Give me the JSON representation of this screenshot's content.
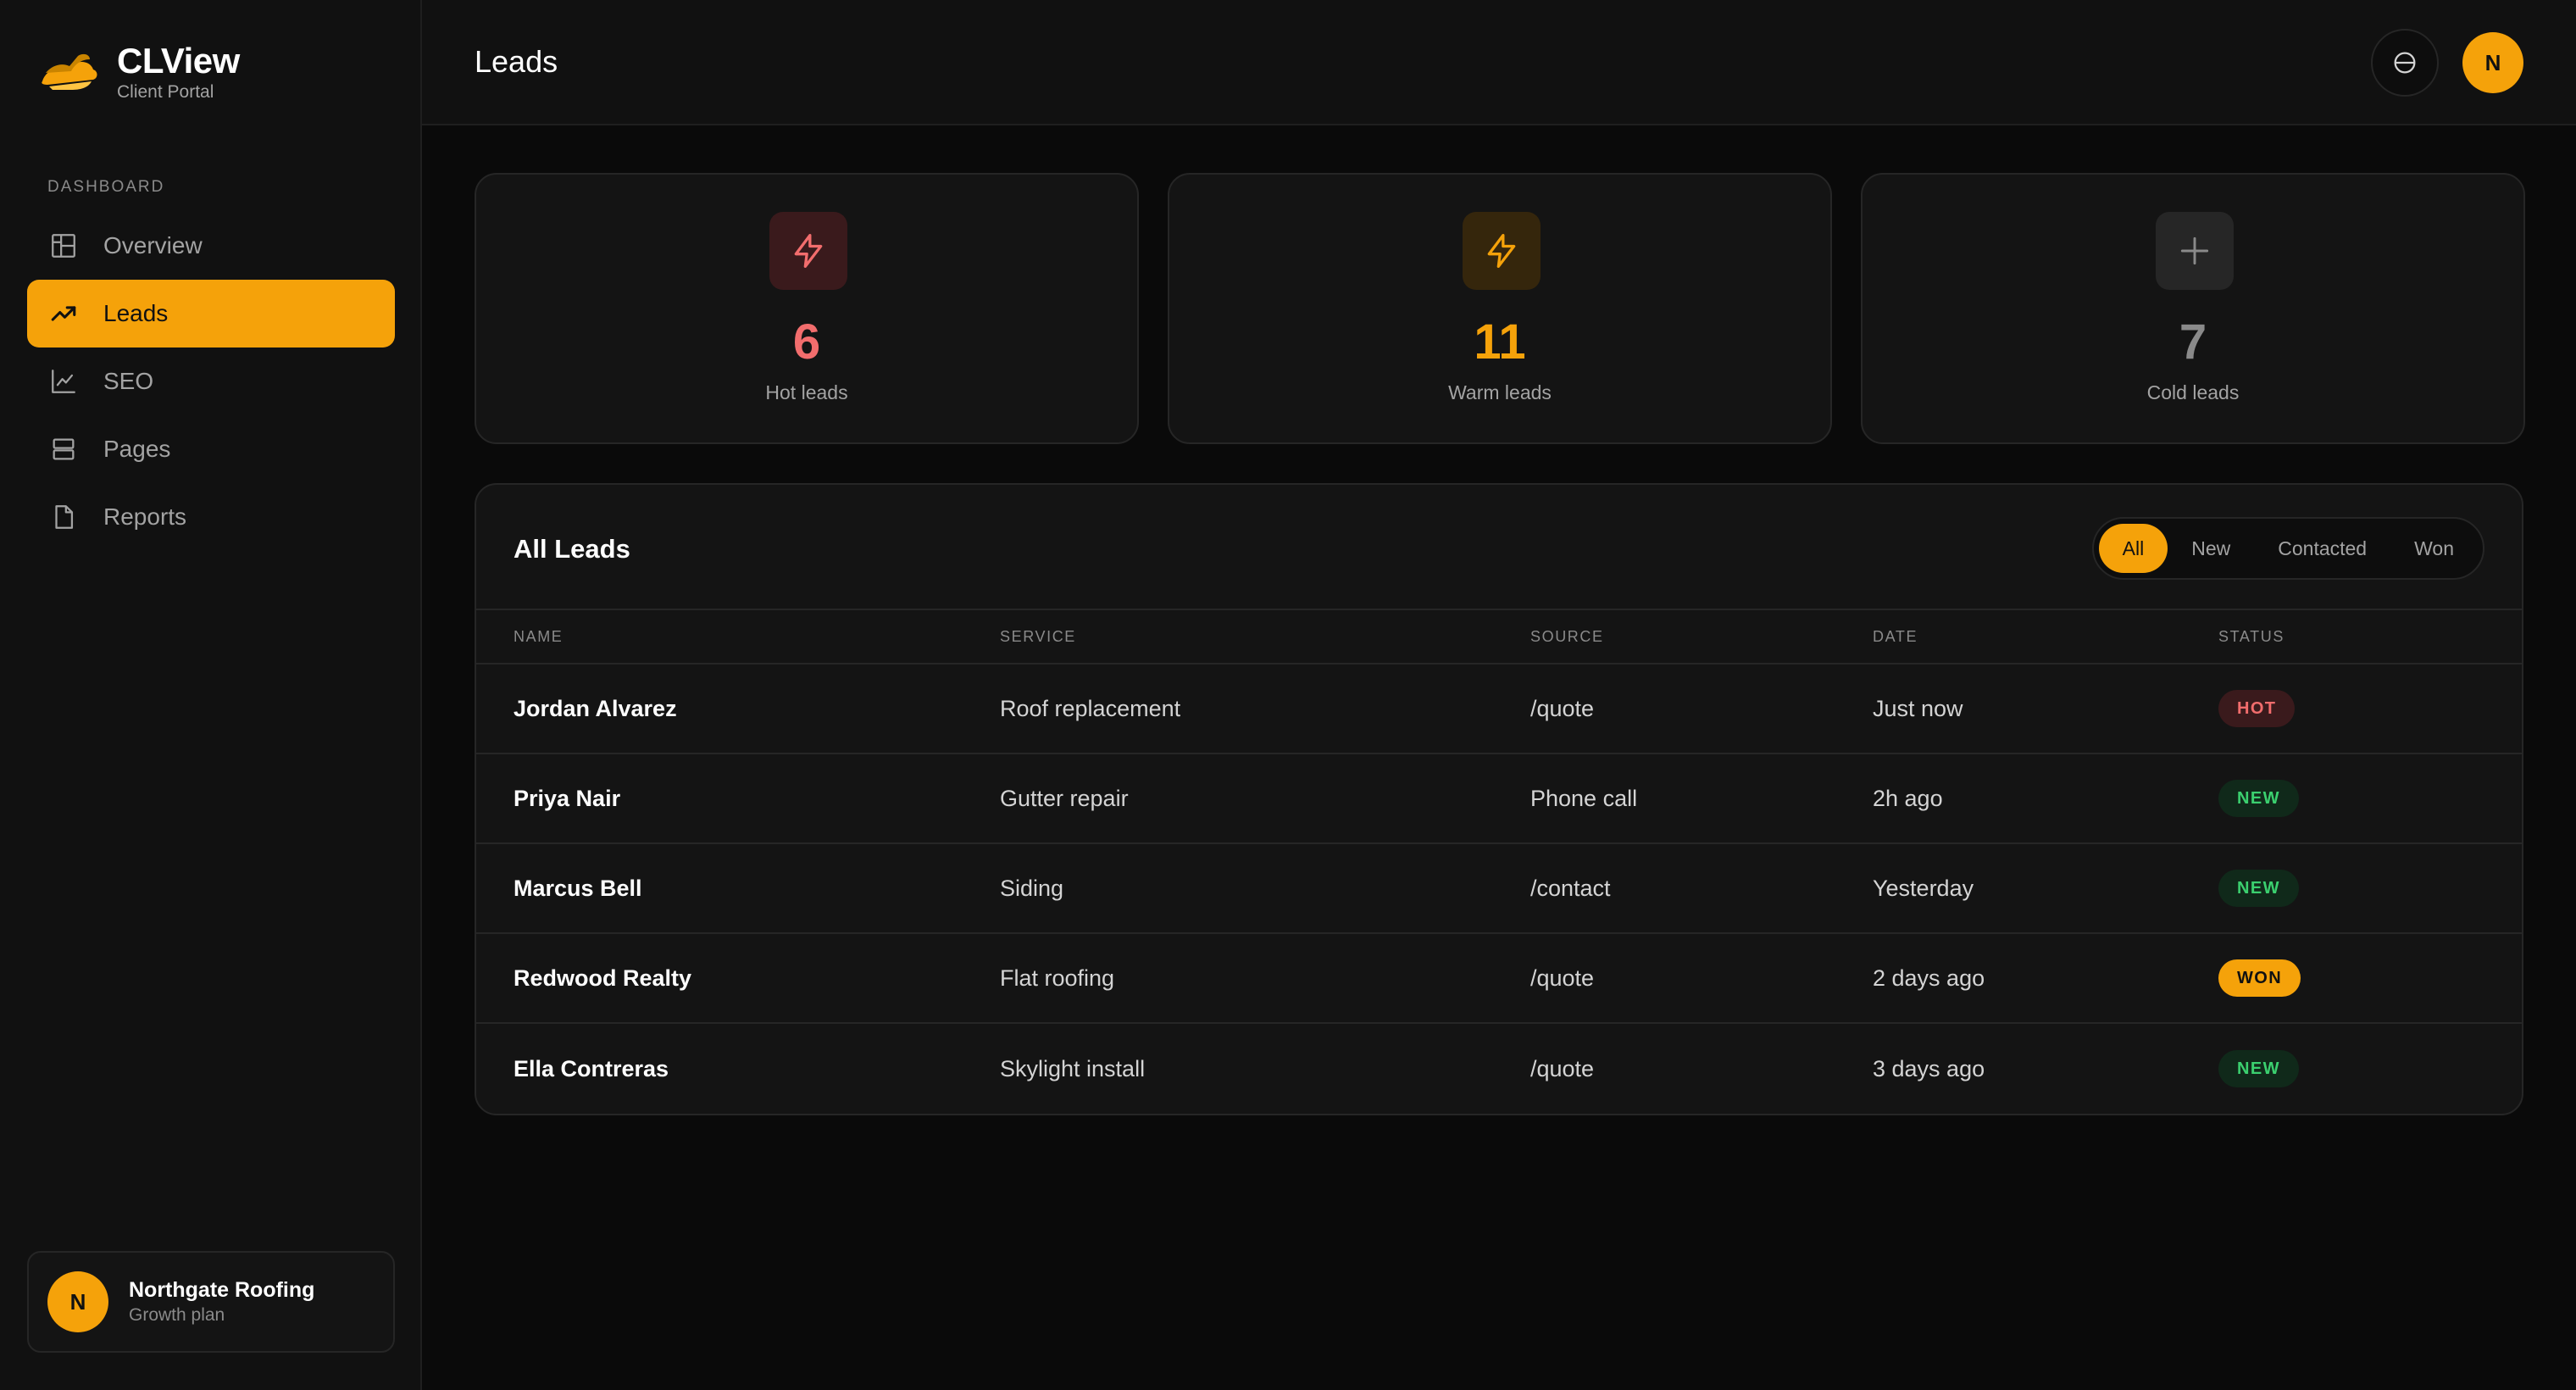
{
  "brand": {
    "name": "CLView",
    "subtitle": "Client Portal"
  },
  "sidebar": {
    "section_label": "DASHBOARD",
    "items": [
      {
        "label": "Overview",
        "icon": "layout-icon",
        "active": false
      },
      {
        "label": "Leads",
        "icon": "trending-up-icon",
        "active": true
      },
      {
        "label": "SEO",
        "icon": "line-chart-icon",
        "active": false
      },
      {
        "label": "Pages",
        "icon": "rows-icon",
        "active": false
      },
      {
        "label": "Reports",
        "icon": "file-icon",
        "active": false
      }
    ],
    "account": {
      "initial": "N",
      "name": "Northgate Roofing",
      "plan": "Growth plan"
    }
  },
  "header": {
    "title": "Leads",
    "avatar_initial": "N"
  },
  "stats": [
    {
      "value": "6",
      "label": "Hot leads",
      "icon": "bolt-icon",
      "color": "#f26d6d"
    },
    {
      "value": "11",
      "label": "Warm leads",
      "icon": "bolt-icon",
      "color": "#f5a20a"
    },
    {
      "value": "7",
      "label": "Cold leads",
      "icon": "plus-icon",
      "color": "#8a8a8a"
    }
  ],
  "leads": {
    "title": "All Leads",
    "filters": [
      "All",
      "New",
      "Contacted",
      "Won"
    ],
    "active_filter": "All",
    "columns": [
      "NAME",
      "SERVICE",
      "SOURCE",
      "DATE",
      "STATUS"
    ],
    "rows": [
      {
        "name": "Jordan Alvarez",
        "service": "Roof replacement",
        "source": "/quote",
        "date": "Just now",
        "status": "HOT"
      },
      {
        "name": "Priya Nair",
        "service": "Gutter repair",
        "source": "Phone call",
        "date": "2h ago",
        "status": "NEW"
      },
      {
        "name": "Marcus Bell",
        "service": "Siding",
        "source": "/contact",
        "date": "Yesterday",
        "status": "NEW"
      },
      {
        "name": "Redwood Realty",
        "service": "Flat roofing",
        "source": "/quote",
        "date": "2 days ago",
        "status": "WON"
      },
      {
        "name": "Ella Contreras",
        "service": "Skylight install",
        "source": "/quote",
        "date": "3 days ago",
        "status": "NEW"
      }
    ]
  },
  "colors": {
    "accent": "#f5a20a",
    "hot": "#f26d6d",
    "new": "#3bd06f",
    "background": "#0a0a0a"
  }
}
